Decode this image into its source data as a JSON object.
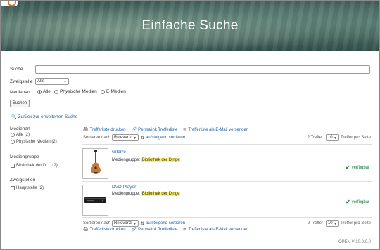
{
  "banner": {
    "title": "Einfache Suche"
  },
  "form": {
    "search_label": "Suche",
    "search_value": "",
    "branch_label": "Zweigstelle",
    "branch_value": "Alle",
    "medium_label": "Medienart",
    "medium_options": [
      "Alle",
      "Physische Medien",
      "E-Medien"
    ],
    "submit_label": "Suchen",
    "advanced_link": "Zurück zur erweiterten Suche"
  },
  "facets": {
    "medienart_title": "Medienart",
    "medienart_items": [
      "Alle (2)",
      "Physische Medien (2)"
    ],
    "mediengruppe_title": "Mediengruppe",
    "mediengruppe_items": [
      "Bibliothek der D...",
      "(2)"
    ],
    "zweigstellen_title": "Zweigstellen",
    "zweigstellen_items": [
      "Hauptstelle (2)"
    ]
  },
  "toolbar": {
    "print": "Trefferliste drucken",
    "permalink": "Permalink Trefferliste",
    "email": "Trefferliste als E-Mail versenden",
    "sort_label": "Sortieren nach",
    "sort_value": "Relevanz",
    "sort_order": "aufsteigend sortieren",
    "hits_label": "2 Treffer",
    "per_page_value": "10",
    "per_page_label": "Treffer pro Seite"
  },
  "results": [
    {
      "title": "Gitarre",
      "group_label": "Mediengruppe:",
      "group_value": "Bibliothek der Dinge",
      "status": "verfügbar",
      "icon": "guitar-icon"
    },
    {
      "title": "DVD-Player",
      "group_label": "Mediengruppe:",
      "group_value": "Bibliothek der Dinge",
      "status": "verfügbar",
      "icon": "dvd-player-icon"
    }
  ],
  "footer": {
    "version": "OPEN V 10.0.0.0"
  },
  "colors": {
    "link": "#1b5fa8",
    "highlight": "#fff16e",
    "available": "#1f7d3a",
    "logo": "#e06b2b"
  }
}
